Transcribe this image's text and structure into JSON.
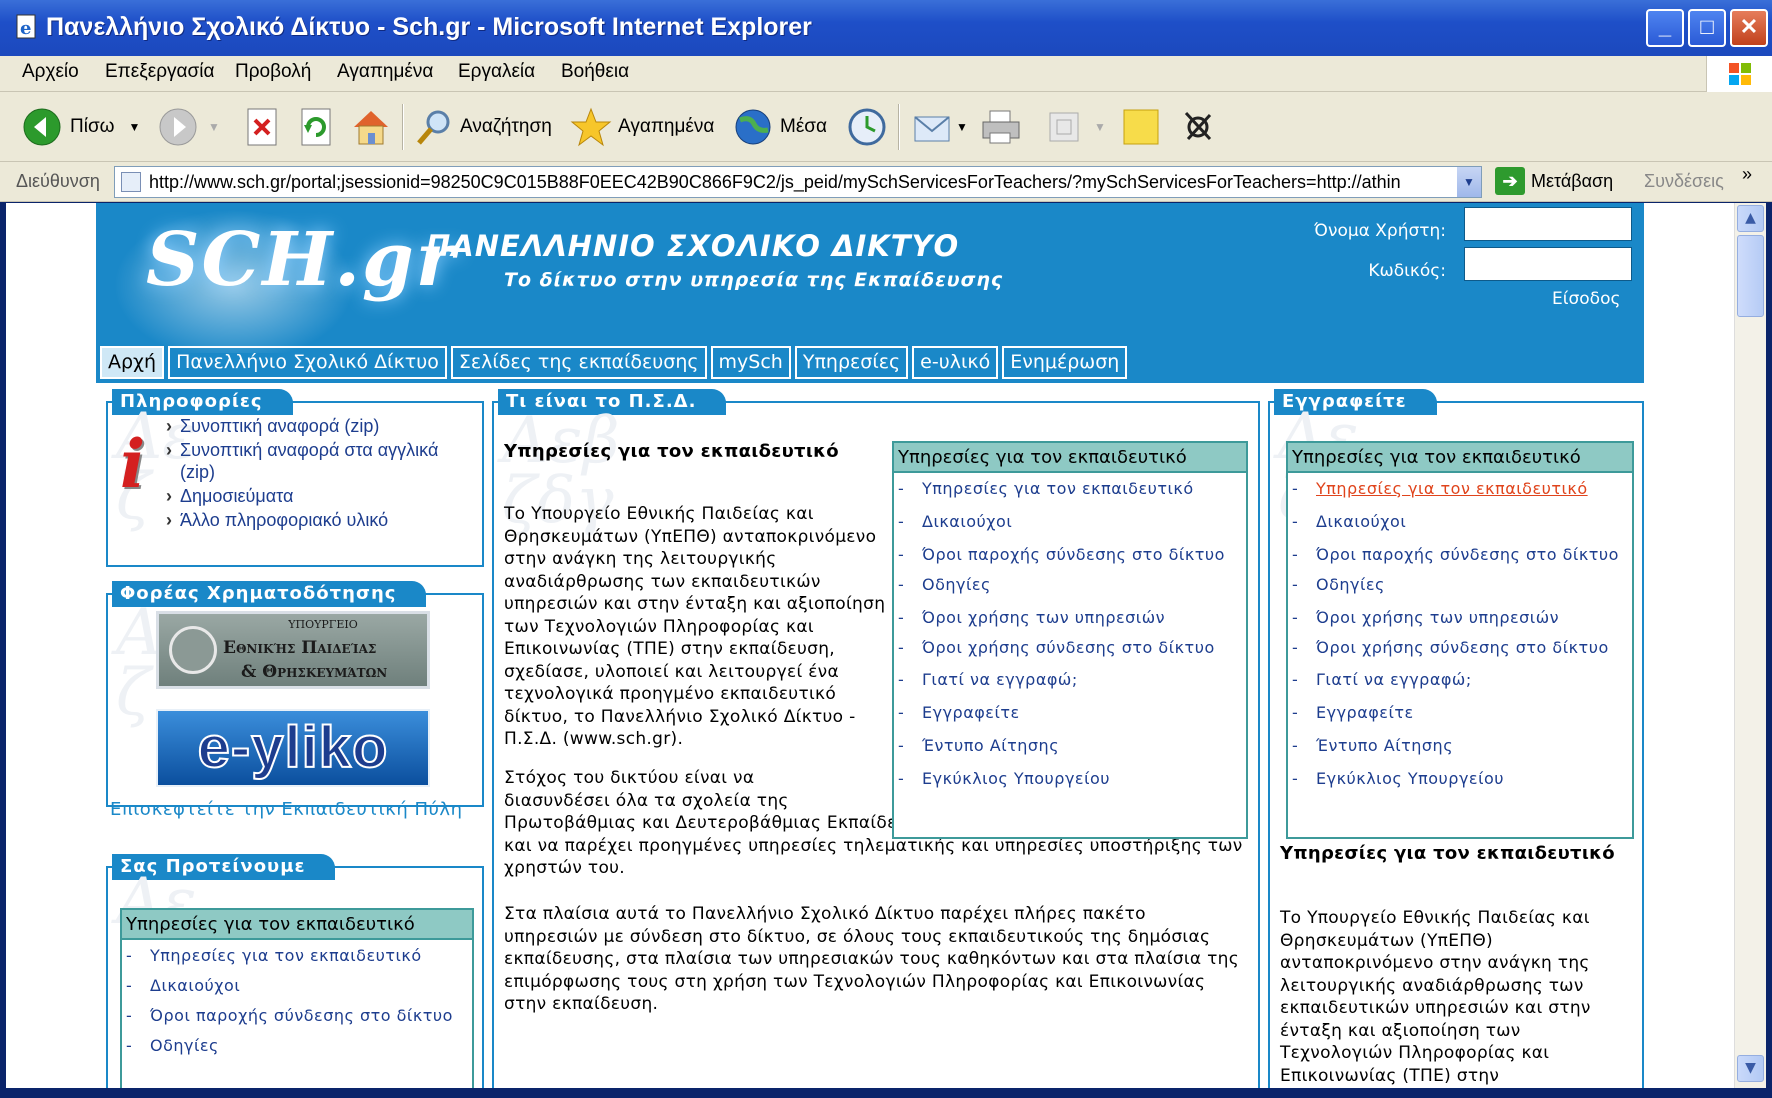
{
  "window": {
    "title": "Πανελλήνιο Σχολικό Δίκτυο - Sch.gr - Microsoft Internet Explorer"
  },
  "menu": [
    "Αρχείο",
    "Επεξεργασία",
    "Προβολή",
    "Αγαπημένα",
    "Εργαλεία",
    "Βοήθεια"
  ],
  "toolbar": {
    "back": "Πίσω",
    "search": "Αναζήτηση",
    "favorites": "Αγαπημένα",
    "media": "Μέσα"
  },
  "address": {
    "label": "Διεύθυνση",
    "url": "http://www.sch.gr/portal;jsessionid=98250C9C015B88F0EEC42B90C866F9C2/js_peid/mySchServicesForTeachers/?mySchServicesForTeachers=http://athin",
    "go": "Μετάβαση",
    "links": "Συνδέσεις"
  },
  "site": {
    "logo": "SCH.gr",
    "title": "ΠΑΝΕΛΛΗΝΙΟ ΣΧΟΛΙΚΟ ΔΙΚΤΥΟ",
    "subtitle": "Το δίκτυο στην υπηρεσία της Εκπαίδευσης",
    "login": {
      "username_label": "Όνομα Χρήστη:",
      "password_label": "Κωδικός:",
      "submit": "Είσοδος"
    },
    "nav": [
      "Αρχή",
      "Πανελλήνιο Σχολικό Δίκτυο",
      "Σελίδες της εκπαίδευσης",
      "mySch",
      "Υπηρεσίες",
      "e-υλικό",
      "Ενημέρωση"
    ]
  },
  "left": {
    "info": {
      "title": "Πληροφορίες",
      "items": [
        "Συνοπτική αναφορά (zip)",
        "Συνοπτική αναφορά στα αγγλικά (zip)",
        "Δημοσιεύματα",
        "Άλλο πληροφοριακό υλικό"
      ]
    },
    "funding": {
      "title": "Φορέας Χρηματοδότησης",
      "ministry_l1": "ΥΠΟΥΡΓΕΙΟ",
      "ministry_l2": "Εθνικής Παιδείας",
      "ministry_l3": "& Θρησκευμάτων",
      "eyliko": "e-yliko",
      "portal_link": "Επισκεφτείτε την Εκπαιδευτική Πύλη"
    },
    "suggest": {
      "title": "Σας Προτείνουμε",
      "box_title": "Υπηρεσίες για τον εκπαιδευτικό",
      "items": [
        "Υπηρεσίες για τον εκπαιδευτικό",
        "Δικαιούχοι",
        "Όροι παροχής σύνδεσης στο δίκτυο",
        "Οδηγίες"
      ]
    }
  },
  "center": {
    "title": "Τι είναι το Π.Σ.Δ.",
    "heading": "Υπηρεσίες για τον εκπαιδευτικό",
    "p1": "Το Υπουργείο Εθνικής Παιδείας και Θρησκευμάτων (ΥπΕΠΘ) ανταποκρινόμενο στην ανάγκη της λειτουργικής αναδιάρθρωσης των εκπαιδευτικών υπηρεσιών και στην ένταξη και αξιοποίηση των Τεχνολογιών Πληροφορίας και Επικοινωνίας (ΤΠΕ) στην εκπαίδευση, σχεδίασε, υλοποιεί και λειτουργεί ένα τεχνολογικά προηγμένο εκπαιδευτικό δίκτυο, το Πανελλήνιο Σχολικό Δίκτυο - Π.Σ.Δ. (www.sch.gr).",
    "p2": "Στόχος του δικτύου είναι να διασυνδέσει όλα τα σχολεία της Πρωτοβάθμιας και Δευτεροβάθμιας Εκπαίδευσης σε ένα εκπαιδευτικό ενδοδίκτυο και να παρέχει προηγμένες υπηρεσίες τηλεματικής και υπηρεσίες υποστήριξης των χρηστών του.",
    "p3": "Στα πλαίσια αυτά το Πανελλήνιο Σχολικό Δίκτυο παρέχει πλήρες πακέτο υπηρεσιών με σύνδεση στο δίκτυο, σε όλους τους εκπαιδευτικούς της δημόσιας εκπαίδευσης, στα πλαίσια των υπηρεσιακών τους καθηκόντων και στα πλαίσια της επιμόρφωσης τους στη χρήση των Τεχνολογιών Πληροφορίας και Επικοινωνίας στην εκπαίδευση.",
    "box": {
      "title": "Υπηρεσίες για τον εκπαιδευτικό",
      "items": [
        "Υπηρεσίες για τον εκπαιδευτικό",
        "Δικαιούχοι",
        "Όροι παροχής σύνδεσης στο δίκτυο",
        "Οδηγίες",
        "Όροι χρήσης των υπηρεσιών",
        "Όροι χρήσης σύνδεσης στο δίκτυο",
        "Γιατί να εγγραφώ;",
        "Εγγραφείτε",
        "Έντυπο Αίτησης",
        "Εγκύκλιος Υπουργείου"
      ]
    }
  },
  "right": {
    "title": "Εγγραφείτε",
    "box": {
      "title": "Υπηρεσίες για τον εκπαιδευτικό",
      "items": [
        "Υπηρεσίες για τον εκπαιδευτικό",
        "Δικαιούχοι",
        "Όροι παροχής σύνδεσης στο δίκτυο",
        "Οδηγίες",
        "Όροι χρήσης των υπηρεσιών",
        "Όροι χρήσης σύνδεσης στο δίκτυο",
        "Γιατί να εγγραφώ;",
        "Εγγραφείτε",
        "Έντυπο Αίτησης",
        "Εγκύκλιος Υπουργείου"
      ]
    },
    "heading": "Υπηρεσίες για τον εκπαιδευτικό",
    "p1": "Το Υπουργείο Εθνικής Παιδείας και Θρησκευμάτων (ΥπΕΠΘ) ανταποκρινόμενο στην ανάγκη της λειτουργικής αναδιάρθρωσης των εκπαιδευτικών υπηρεσιών και στην ένταξη και αξιοποίηση των Τεχνολογιών Πληροφορίας και Επικοινωνίας (ΤΠΕ) στην"
  }
}
